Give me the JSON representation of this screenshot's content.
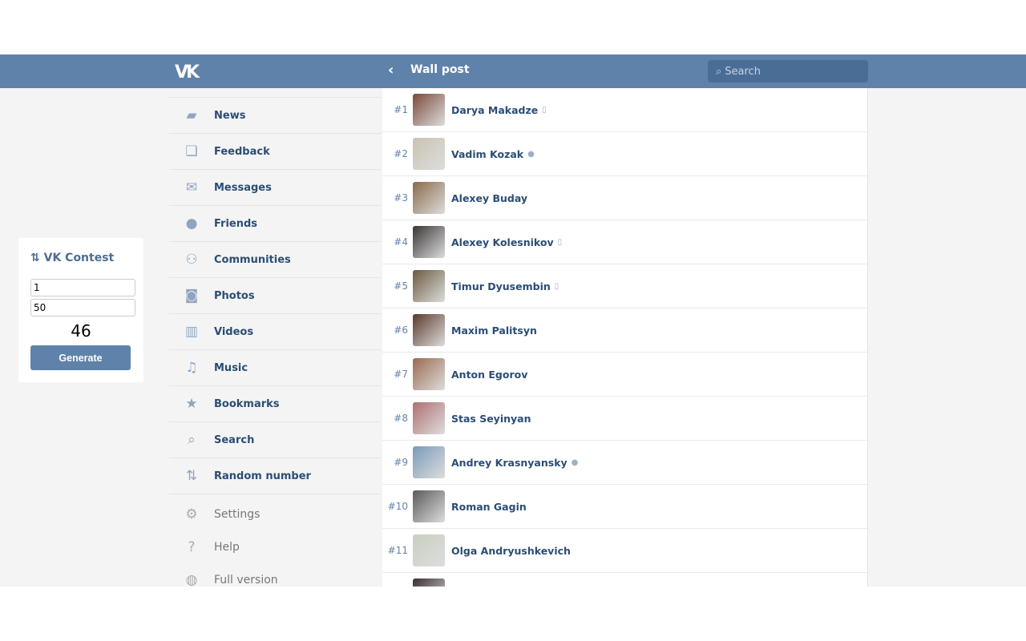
{
  "header": {
    "logo": "VK",
    "back_icon": "chevron-left",
    "title": "Wall post",
    "search_placeholder": "Search"
  },
  "sidebar": {
    "items": [
      {
        "label": "News",
        "icon": "speech-bubble"
      },
      {
        "label": "Feedback",
        "icon": "bubbles"
      },
      {
        "label": "Messages",
        "icon": "envelope"
      },
      {
        "label": "Friends",
        "icon": "person"
      },
      {
        "label": "Communities",
        "icon": "people"
      },
      {
        "label": "Photos",
        "icon": "camera"
      },
      {
        "label": "Videos",
        "icon": "film"
      },
      {
        "label": "Music",
        "icon": "note"
      },
      {
        "label": "Bookmarks",
        "icon": "star"
      },
      {
        "label": "Search",
        "icon": "magnifier"
      },
      {
        "label": "Random number",
        "icon": "repost-arrows"
      }
    ],
    "secondary": [
      {
        "label": "Settings",
        "icon": "gear"
      },
      {
        "label": "Help",
        "icon": "question"
      },
      {
        "label": "Full version",
        "icon": "globe"
      }
    ]
  },
  "list": [
    {
      "num": "#1",
      "name": "Darya Makadze",
      "status": "mobile",
      "color": "#7a4a3a"
    },
    {
      "num": "#2",
      "name": "Vadim Kozak",
      "status": "online",
      "color": "#c9c3b0"
    },
    {
      "num": "#3",
      "name": "Alexey Buday",
      "status": "",
      "color": "#8a6a4a"
    },
    {
      "num": "#4",
      "name": "Alexey Kolesnikov",
      "status": "mobile",
      "color": "#3a3535"
    },
    {
      "num": "#5",
      "name": "Timur Dyusembin",
      "status": "mobile",
      "color": "#6b5a40"
    },
    {
      "num": "#6",
      "name": "Maxim Palitsyn",
      "status": "",
      "color": "#5a3a2a"
    },
    {
      "num": "#7",
      "name": "Anton Egorov",
      "status": "",
      "color": "#9a6a50"
    },
    {
      "num": "#8",
      "name": "Stas Seyinyan",
      "status": "",
      "color": "#b07070"
    },
    {
      "num": "#9",
      "name": "Andrey Krasnyansky",
      "status": "online",
      "color": "#7a9ab8"
    },
    {
      "num": "#10",
      "name": "Roman Gagin",
      "status": "",
      "color": "#5a5a5a"
    },
    {
      "num": "#11",
      "name": "Olga Andryushkevich",
      "status": "",
      "color": "#c8d0c0"
    },
    {
      "num": "",
      "name": "",
      "status": "",
      "color": "#3a3030"
    }
  ],
  "widget": {
    "title": "VK Contest",
    "min": "1",
    "max": "50",
    "result": "46",
    "button": "Generate"
  }
}
